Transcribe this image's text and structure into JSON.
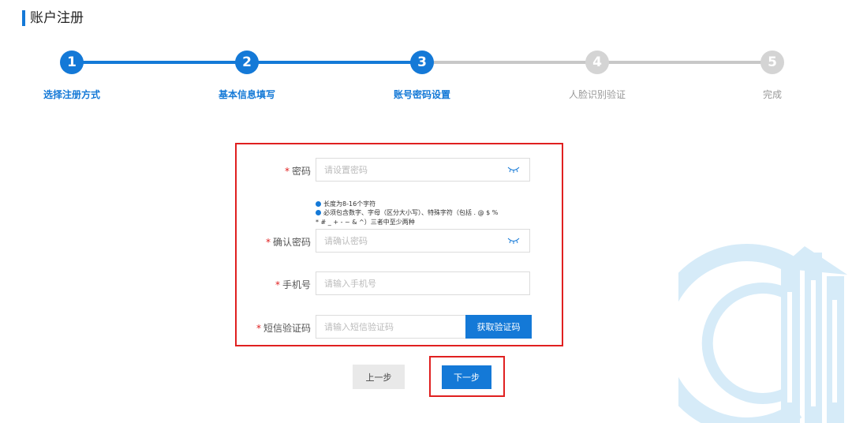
{
  "page_title": "账户注册",
  "steps": [
    {
      "number": "1",
      "label": "选择注册方式",
      "status": "done"
    },
    {
      "number": "2",
      "label": "基本信息填写",
      "status": "done"
    },
    {
      "number": "3",
      "label": "账号密码设置",
      "status": "active"
    },
    {
      "number": "4",
      "label": "人脸识别验证",
      "status": "pending"
    },
    {
      "number": "5",
      "label": "完成",
      "status": "pending"
    }
  ],
  "form": {
    "required_mark": "*",
    "password": {
      "label": "密码",
      "value": "",
      "placeholder": "请设置密码"
    },
    "hints": [
      "长度为8-16个字符",
      "必须包含数字、字母（区分大小写）、特殊字符（包括 . @ $ %",
      "* # _ + - ~ & ^）三者中至少两种"
    ],
    "confirm_password": {
      "label": "确认密码",
      "value": "",
      "placeholder": "请确认密码"
    },
    "phone": {
      "label": "手机号",
      "value": "",
      "placeholder": "请输入手机号"
    },
    "sms_code": {
      "label": "短信验证码",
      "value": "",
      "placeholder": "请输入短信验证码",
      "button_label": "获取验证码"
    }
  },
  "buttons": {
    "prev_label": "上一步",
    "next_label": "下一步"
  },
  "colors": {
    "accent": "#1479d7",
    "inactive": "#c8c8c8",
    "highlight": "#e02020"
  }
}
